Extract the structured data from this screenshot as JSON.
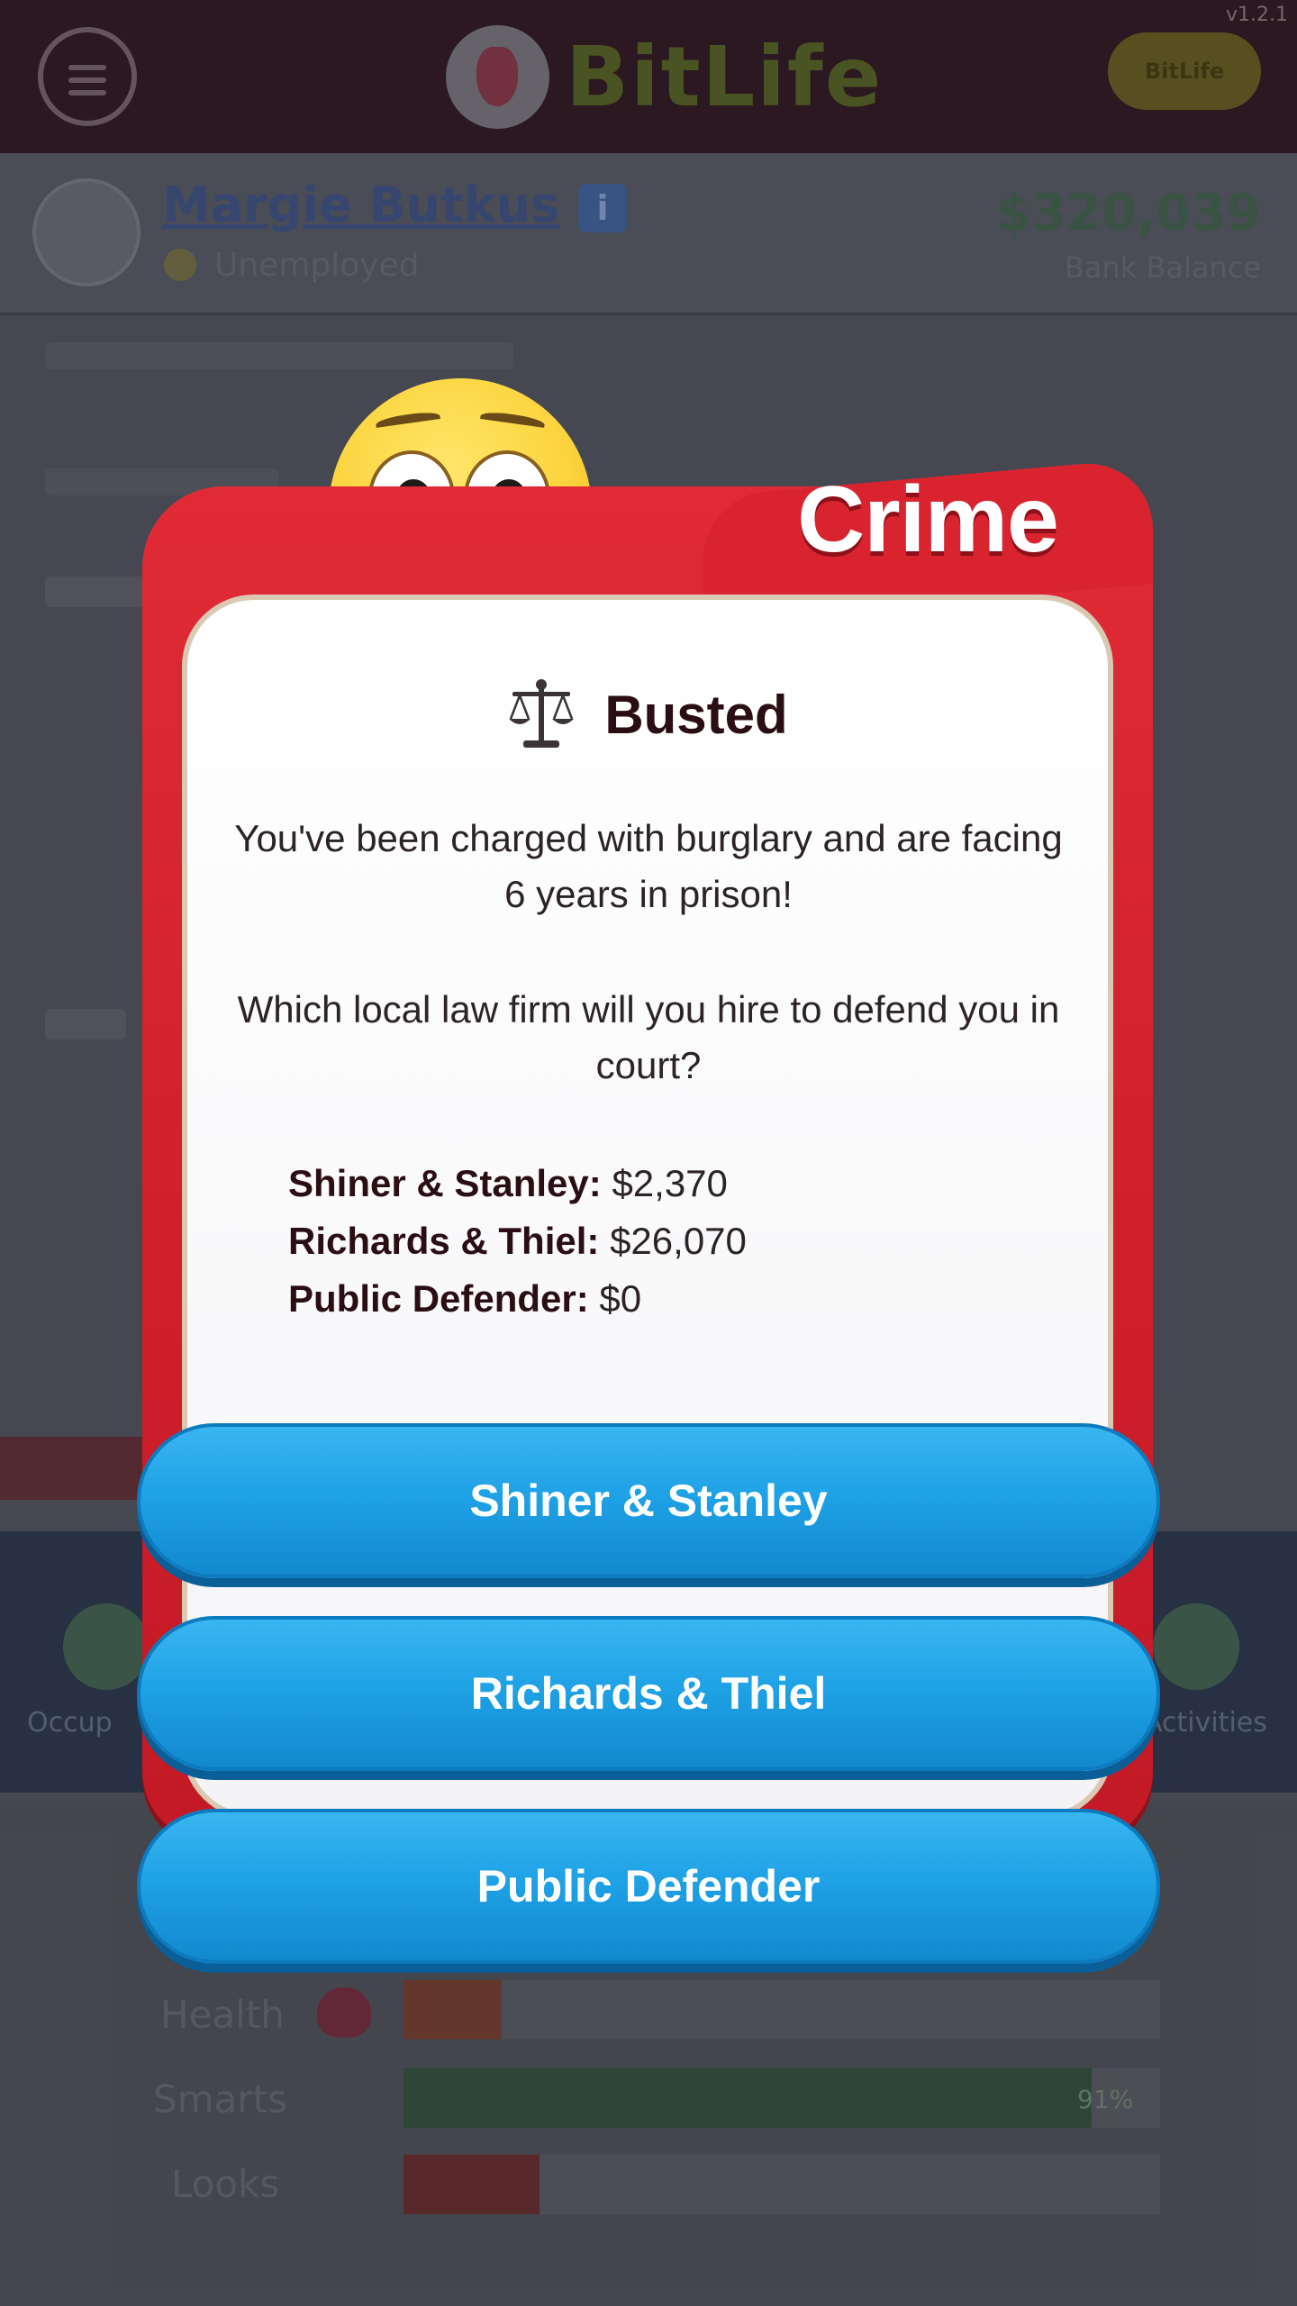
{
  "app": {
    "logo_text": "BitLife",
    "version": "v1.2.1",
    "top_badge": "BitLife"
  },
  "profile": {
    "name": "Margie Butkus",
    "status": "Unemployed",
    "balance": "$320,039",
    "balance_label": "Bank Balance"
  },
  "stats": {
    "health_label": "Health",
    "smarts_label": "Smarts",
    "smarts_value": "91%",
    "looks_label": "Looks",
    "health_pct": 0.13,
    "smarts_pct": 0.91,
    "looks_pct": 0.18
  },
  "nav": {
    "left_label": "Occup",
    "right_label": "Activities"
  },
  "modal": {
    "category": "Crime",
    "title": "Busted",
    "message_1": "You've been charged with burglary and are facing 6 years in prison!",
    "message_2": "Which local law firm will you hire to defend you in court?",
    "fees": [
      {
        "name": "Shiner & Stanley:",
        "cost": "$2,370"
      },
      {
        "name": "Richards & Thiel:",
        "cost": "$26,070"
      },
      {
        "name": "Public Defender:",
        "cost": "$0"
      }
    ],
    "choices": [
      "Shiner & Stanley",
      "Richards & Thiel",
      "Public Defender"
    ]
  },
  "colors": {
    "frame_red": "#d92430",
    "button_blue": "#1fa2e6",
    "title_text": "#2a0e14"
  }
}
